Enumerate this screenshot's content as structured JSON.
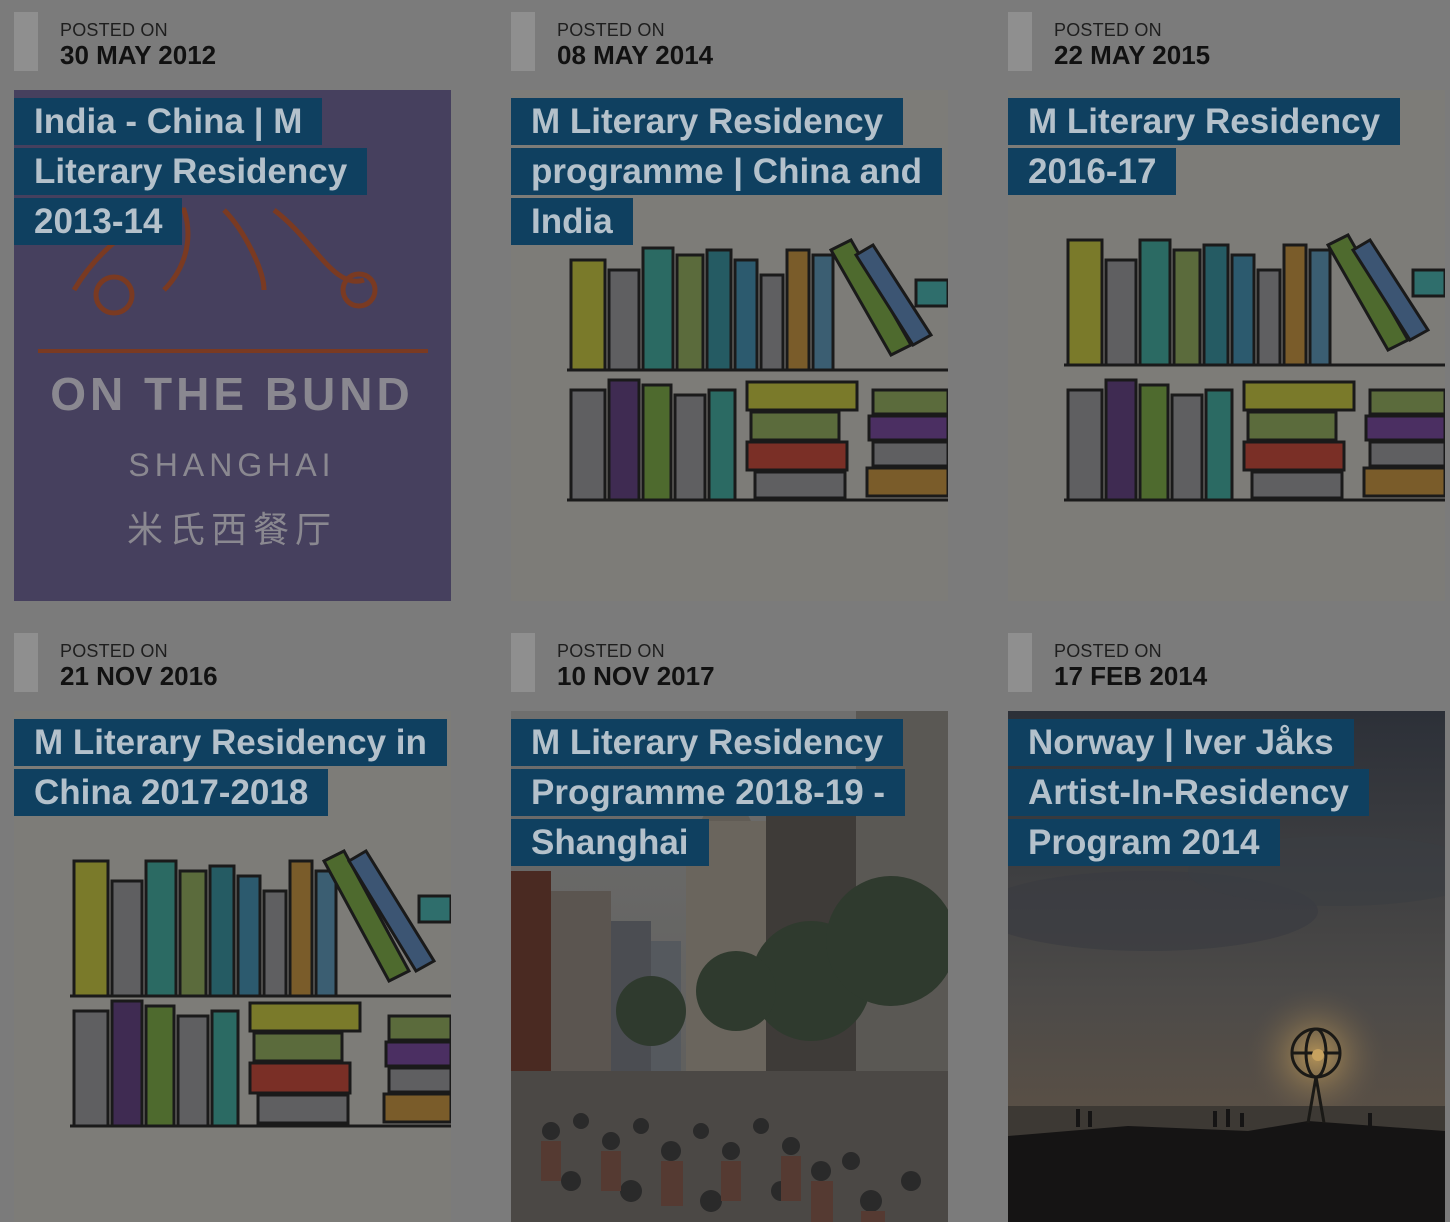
{
  "overlay_color": "#7b7b7b",
  "title_bg": "#0f4060",
  "posts": [
    {
      "posted_label": "POSTED ON",
      "date": "30 MAY 2012",
      "title": "India - China | M Literary Residency 2013-14",
      "image": "m-on-the-bund-logo",
      "logo": {
        "bund": "ON THE BUND",
        "city": "SHANGHAI",
        "chinese": "米氏西餐厅"
      }
    },
    {
      "posted_label": "POSTED ON",
      "date": "08 MAY 2014",
      "title": "M Literary Residency programme | China and India",
      "image": "bookshelf-illustration"
    },
    {
      "posted_label": "POSTED ON",
      "date": "22 MAY 2015",
      "title": "M Literary Residency 2016-17",
      "image": "bookshelf-illustration"
    },
    {
      "posted_label": "POSTED ON",
      "date": "21 NOV 2016",
      "title": "M Literary Residency in China 2017-2018",
      "image": "bookshelf-illustration"
    },
    {
      "posted_label": "POSTED ON",
      "date": "10 NOV 2017",
      "title": "M Literary Residency Programme 2018-19 - Shanghai",
      "image": "shanghai-street-photo"
    },
    {
      "posted_label": "POSTED ON",
      "date": "17 FEB 2014",
      "title": "Norway | Iver Jåks Artist-In-Residency Program 2014",
      "image": "north-cape-globe-photo"
    }
  ]
}
